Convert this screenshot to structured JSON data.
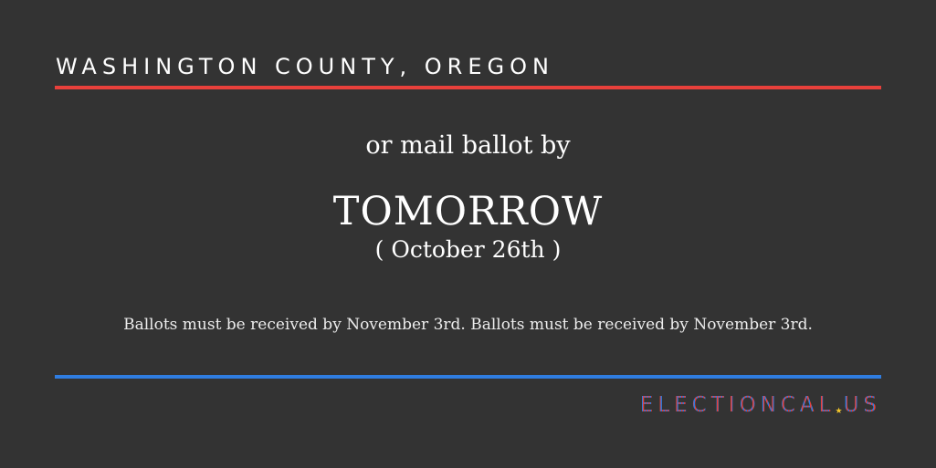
{
  "header": {
    "county": "WASHINGTON COUNTY, OREGON"
  },
  "message": {
    "lead": "or mail ballot by",
    "deadline": "TOMORROW",
    "date": "( October 26th )",
    "note": "Ballots must be received by November 3rd. Ballots must be received by November 3rd."
  },
  "logo": {
    "name_part": "ELECTIONCAL",
    "tld": "US",
    "icon": "star-icon"
  },
  "colors": {
    "background": "#333333",
    "red_rule": "#e8403b",
    "blue_rule": "#2f7de1",
    "star": "#f2c62b"
  }
}
